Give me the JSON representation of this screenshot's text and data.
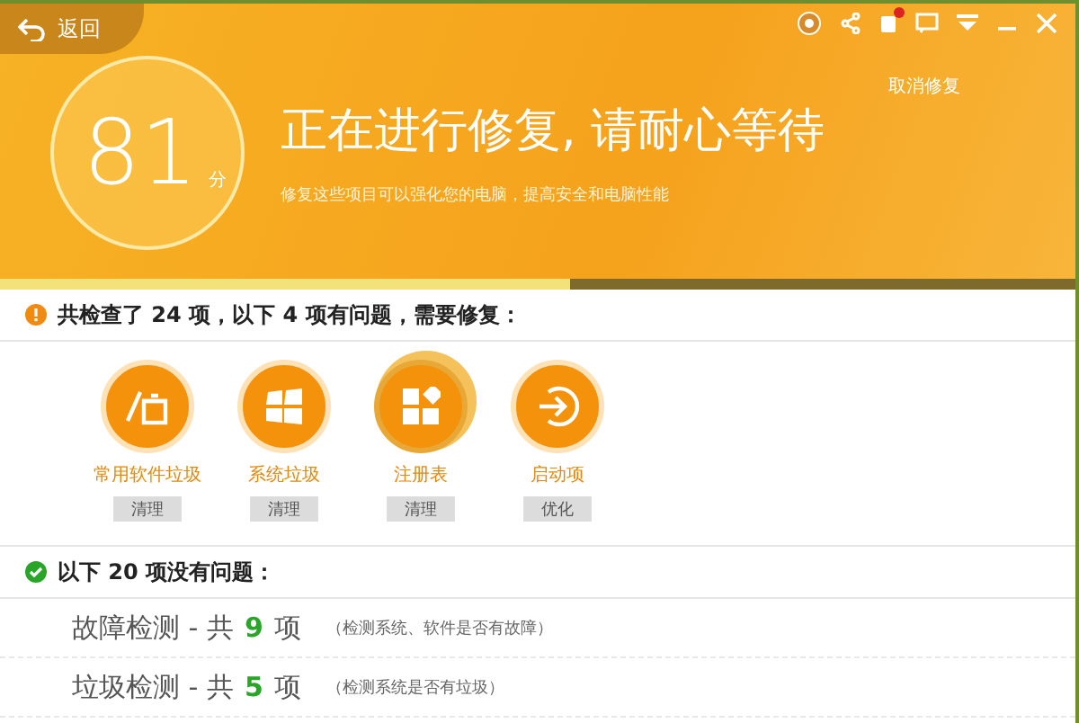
{
  "top_bar": {
    "back": "返回"
  },
  "score": {
    "value": "81",
    "unit": "分"
  },
  "status": {
    "title": "正在进行修复, 请耐心等待",
    "subtitle": "修复这些项目可以强化您的电脑，提高安全和电脑性能",
    "cancel": "取消修复"
  },
  "progress": {
    "level": 0.53
  },
  "problems": {
    "heading": "共检查了 24 项，以下 4 项有问题，需要修复：",
    "items": [
      {
        "kind": "software",
        "label": "常用软件垃圾",
        "action": "清理",
        "active": false
      },
      {
        "kind": "system",
        "label": "系统垃圾",
        "action": "清理",
        "active": false
      },
      {
        "kind": "registry",
        "label": "注册表",
        "action": "清理",
        "active": true
      },
      {
        "kind": "startup",
        "label": "启动项",
        "action": "优化",
        "active": false
      }
    ]
  },
  "ok": {
    "heading": "以下 20 项没有问题：",
    "rows": [
      {
        "name": "故障检测 - 共",
        "count": "9",
        "unit": "项",
        "note": "（检测系统、软件是否有故障）"
      },
      {
        "name": "垃圾检测 - 共",
        "count": "5",
        "unit": "项",
        "note": "（检测系统是否有垃圾）"
      }
    ]
  }
}
